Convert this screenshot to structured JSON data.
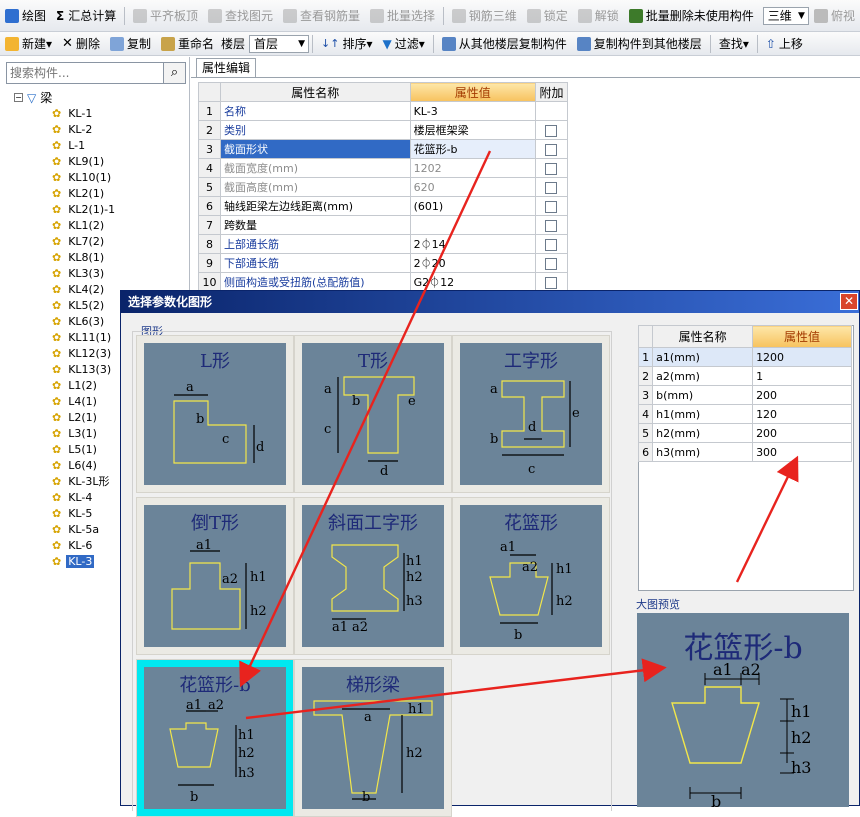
{
  "toolbar1": {
    "items": [
      {
        "label": "绘图",
        "disabled": false,
        "color": "#2f6fd0"
      },
      {
        "label": "汇总计算",
        "disabled": false,
        "color": "#333333",
        "prefix": "Σ"
      },
      {
        "label": "平齐板顶",
        "disabled": true,
        "color": "#9a9a9a"
      },
      {
        "label": "查找图元",
        "disabled": true,
        "color": "#9a9a9a"
      },
      {
        "label": "查看钢筋量",
        "disabled": true,
        "color": "#9a9a9a"
      },
      {
        "label": "批量选择",
        "disabled": true,
        "color": "#9a9a9a"
      },
      {
        "label": "钢筋三维",
        "disabled": true,
        "color": "#9a9a9a"
      },
      {
        "label": "锁定",
        "disabled": true,
        "color": "#9a9a9a"
      },
      {
        "label": "解锁",
        "disabled": true,
        "color": "#9a9a9a"
      },
      {
        "label": "批量删除未使用构件",
        "disabled": false,
        "color": "#3d7a2a"
      }
    ],
    "view_mode": "三维",
    "truncated_item": "俯视"
  },
  "toolbar2": {
    "new_label": "新建",
    "delete_label": "删除",
    "copy_label": "复制",
    "rename_label": "重命名",
    "floor_label": "楼层",
    "floor_value": "首层",
    "sort_label": "排序",
    "filter_label": "过滤",
    "copy_from_label": "从其他楼层复制构件",
    "copy_to_label": "复制构件到其他楼层",
    "find_label": "查找",
    "moveup_label": "上移"
  },
  "sidebar": {
    "search_placeholder": "搜索构件...",
    "root_label": "梁",
    "items": [
      "KL-1",
      "KL-2",
      "L-1",
      "KL9(1)",
      "KL10(1)",
      "KL2(1)",
      "KL2(1)-1",
      "KL1(2)",
      "KL7(2)",
      "KL8(1)",
      "KL3(3)",
      "KL4(2)",
      "KL5(2)",
      "KL6(3)",
      "KL11(1)",
      "KL12(3)",
      "KL13(3)",
      "L1(2)",
      "L4(1)",
      "L2(1)",
      "L3(1)",
      "L5(1)",
      "L6(4)",
      "KL-3L形",
      "KL-4",
      "KL-5",
      "KL-5a",
      "KL-6",
      "KL-3"
    ],
    "selected": "KL-3"
  },
  "prop_panel": {
    "tab_label": "属性编辑",
    "headers": [
      "属性名称",
      "属性值",
      "附加"
    ],
    "rows": [
      {
        "num": "1",
        "name": "名称",
        "value": "KL-3",
        "style": "blue",
        "check": false
      },
      {
        "num": "2",
        "name": "类别",
        "value": "楼层框架梁",
        "style": "blue",
        "check": true
      },
      {
        "num": "3",
        "name": "截面形状",
        "value": "花篮形-b",
        "style": "blue",
        "check": true,
        "selected": true
      },
      {
        "num": "4",
        "name": "截面宽度(mm)",
        "value": "1202",
        "style": "gray",
        "check": true
      },
      {
        "num": "5",
        "name": "截面高度(mm)",
        "value": "620",
        "style": "gray",
        "check": true
      },
      {
        "num": "6",
        "name": "轴线距梁左边线距离(mm)",
        "value": "(601)",
        "style": "black",
        "check": true
      },
      {
        "num": "7",
        "name": "跨数量",
        "value": "",
        "style": "black",
        "check": true
      },
      {
        "num": "8",
        "name": "上部通长筋",
        "value": "2⏀14",
        "style": "blue",
        "check": true
      },
      {
        "num": "9",
        "name": "下部通长筋",
        "value": "2⏀20",
        "style": "blue",
        "check": true
      },
      {
        "num": "10",
        "name": "侧面构造或受扭筋(总配筋值)",
        "value": "G2⏀12",
        "style": "blue",
        "check": true
      }
    ]
  },
  "dialog": {
    "title": "选择参数化图形",
    "close": "✕",
    "group_label": "图形",
    "shapes": [
      {
        "title": "L形",
        "labels": [
          "a",
          "b",
          "c",
          "d"
        ]
      },
      {
        "title": "T形",
        "labels": [
          "a",
          "b",
          "c",
          "d",
          "e"
        ]
      },
      {
        "title": "工字形",
        "labels": [
          "a",
          "b",
          "c",
          "d",
          "e"
        ]
      },
      {
        "title": "倒T形",
        "labels": [
          "a1",
          "a2",
          "h1",
          "h2"
        ]
      },
      {
        "title": "斜面工字形",
        "labels": [
          "h1",
          "h2",
          "h3",
          "a1",
          "a2"
        ]
      },
      {
        "title": "花篮形",
        "labels": [
          "a1",
          "a2",
          "h1",
          "h2",
          "b"
        ]
      },
      {
        "title": "花篮形-b",
        "labels": [
          "a1",
          "a2",
          "h1",
          "h2",
          "h3",
          "b"
        ],
        "selected": true
      },
      {
        "title": "梯形梁",
        "labels": [
          "a",
          "h1",
          "h2",
          "b"
        ]
      }
    ],
    "param_headers": [
      "属性名称",
      "属性值"
    ],
    "params": [
      {
        "num": "1",
        "name": "a1(mm)",
        "value": "1200"
      },
      {
        "num": "2",
        "name": "a2(mm)",
        "value": "1"
      },
      {
        "num": "3",
        "name": "b(mm)",
        "value": "200"
      },
      {
        "num": "4",
        "name": "h1(mm)",
        "value": "120"
      },
      {
        "num": "5",
        "name": "h2(mm)",
        "value": "200"
      },
      {
        "num": "6",
        "name": "h3(mm)",
        "value": "300"
      }
    ],
    "preview_label": "大图预览",
    "preview_title": "花篮形-b",
    "preview_labels": [
      "a1",
      "a2",
      "h1",
      "h2",
      "h3",
      "b"
    ]
  },
  "colors": {
    "arrow": "#e8231e",
    "shape_bg": "#6b8499",
    "shape_line": "#f2e64a",
    "title_blue": "#1e2a78",
    "selected_cell": "#00e8f0"
  }
}
